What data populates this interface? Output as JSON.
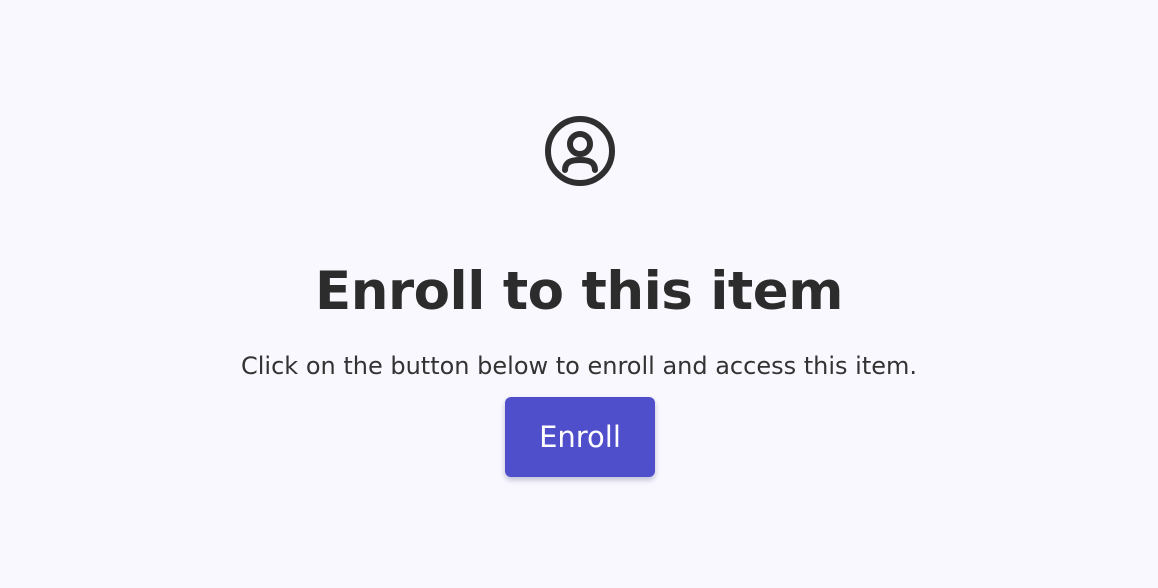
{
  "enroll": {
    "icon": "user-circle-icon",
    "title": "Enroll to this item",
    "description": "Click on the button below to enroll and access this item.",
    "button_label": "Enroll"
  },
  "colors": {
    "background": "#f9f8fe",
    "text": "#2f2f2f",
    "button": "#4f4fcb",
    "button_text": "#ffffff"
  }
}
